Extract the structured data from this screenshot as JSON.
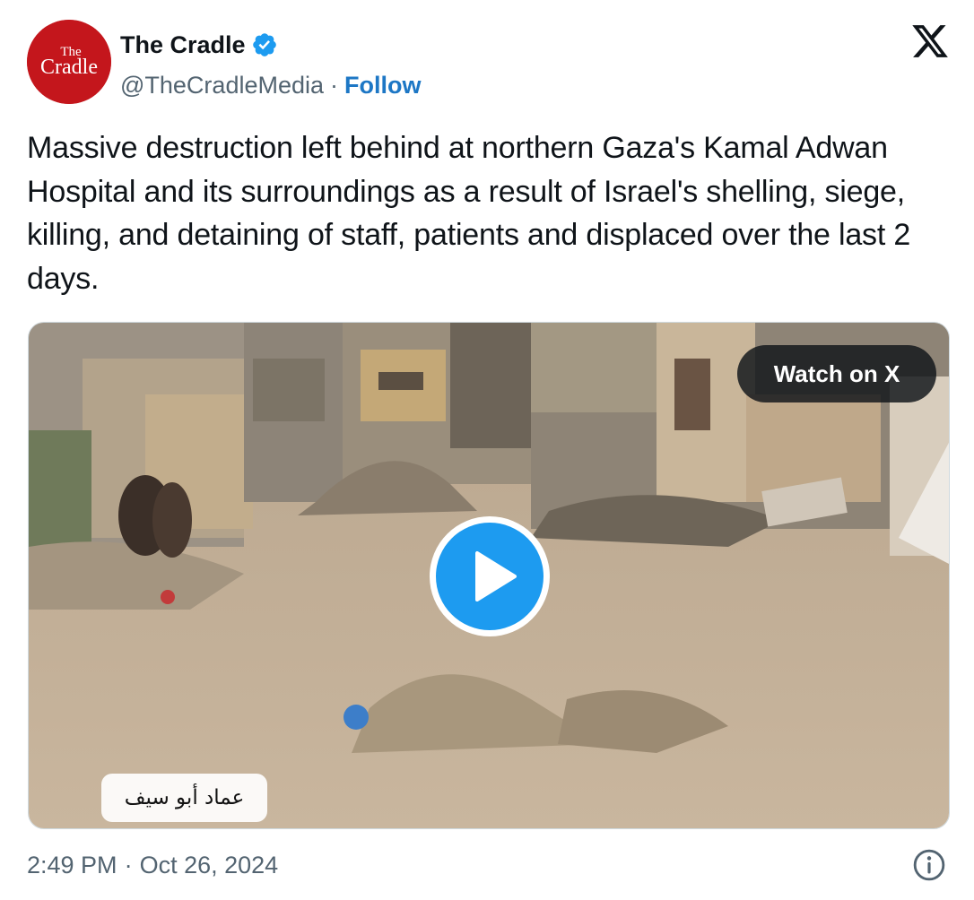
{
  "author": {
    "avatar_text_top": "The",
    "avatar_text_bottom": "Cradle",
    "display_name": "The Cradle",
    "handle": "@TheCradleMedia",
    "separator": "·",
    "follow_label": "Follow",
    "verified_icon": "verified-badge-icon"
  },
  "platform_icon": "x-logo-icon",
  "tweet": {
    "text": "Massive destruction left behind at northern Gaza's Kamal Adwan Hospital and its surroundings as a result of Israel's shelling, siege, killing, and detaining of staff, patients and displaced over the last 2 days."
  },
  "media": {
    "watch_label": "Watch on X",
    "play_icon": "play-icon",
    "video_caption": "عماد أبو سيف"
  },
  "footer": {
    "time": "2:49 PM",
    "separator": "·",
    "date": "Oct 26, 2024",
    "info_icon": "info-icon"
  },
  "colors": {
    "avatar_red": "#c4161c",
    "verified_blue": "#1d9bf0",
    "follow_blue": "#1d77c5",
    "secondary_text": "#536471",
    "play_blue": "#1d9bf0"
  }
}
